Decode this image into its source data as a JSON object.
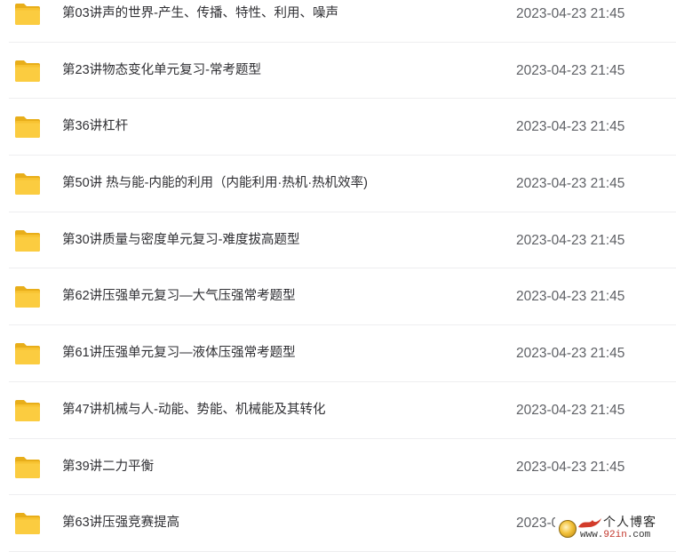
{
  "files": [
    {
      "name": "第03讲声的世界-产生、传播、特性、利用、噪声",
      "date": "2023-04-23 21:45",
      "icon": "folder-icon"
    },
    {
      "name": "第23讲物态变化单元复习-常考题型",
      "date": "2023-04-23 21:45",
      "icon": "folder-icon"
    },
    {
      "name": "第36讲杠杆",
      "date": "2023-04-23 21:45",
      "icon": "folder-icon"
    },
    {
      "name": "第50讲 热与能-内能的利用（内能利用·热机·热机效率)",
      "date": "2023-04-23 21:45",
      "icon": "folder-icon"
    },
    {
      "name": "第30讲质量与密度单元复习-难度拔高题型",
      "date": "2023-04-23 21:45",
      "icon": "folder-icon"
    },
    {
      "name": "第62讲压强单元复习—大气压强常考题型",
      "date": "2023-04-23 21:45",
      "icon": "folder-icon"
    },
    {
      "name": "第61讲压强单元复习—液体压强常考题型",
      "date": "2023-04-23 21:45",
      "icon": "folder-icon"
    },
    {
      "name": "第47讲机械与人-动能、势能、机械能及其转化",
      "date": "2023-04-23 21:45",
      "icon": "folder-icon"
    },
    {
      "name": "第39讲二力平衡",
      "date": "2023-04-23 21:45",
      "icon": "folder-icon"
    },
    {
      "name": "第63讲压强竞赛提高",
      "date": "2023-0",
      "icon": "folder-icon"
    }
  ],
  "watermark": {
    "title": "个人博客",
    "url_prefix": "www.",
    "url_accent": "92in",
    "url_suffix": ".com"
  },
  "colors": {
    "folder_body": "#F7C230",
    "folder_tab": "#E8AE1A",
    "folder_front": "#FFD54F",
    "name_text": "#2f2f33",
    "date_text": "#5f6166",
    "divider": "#eeeef0"
  }
}
